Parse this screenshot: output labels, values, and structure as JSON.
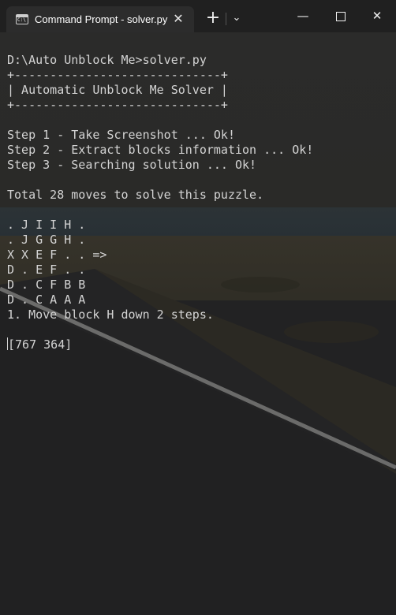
{
  "window": {
    "tab_title": "Command Prompt - solver.py",
    "tab_close_glyph": "✕",
    "new_tab_glyph": "+",
    "dropdown_glyph": "⌄",
    "minimize_glyph": "—",
    "close_glyph": "✕"
  },
  "icons": {
    "tab": "console-icon",
    "tab_close": "close-icon",
    "new_tab": "plus-icon",
    "dropdown": "chevron-down-icon",
    "minimize": "minimize-icon",
    "maximize": "maximize-icon",
    "close": "close-icon"
  },
  "console": {
    "lines": [
      "D:\\Auto Unblock Me>solver.py",
      "+-----------------------------+",
      "| Automatic Unblock Me Solver |",
      "+-----------------------------+",
      "",
      "Step 1 - Take Screenshot ... Ok!",
      "Step 2 - Extract blocks information ... Ok!",
      "Step 3 - Searching solution ... Ok!",
      "",
      "Total 28 moves to solve this puzzle.",
      "",
      ". J I I H .",
      ". J G G H .",
      "X X E F . . =>",
      "D . E F . .",
      "D . C F B B",
      "D . C A A A",
      "1. Move block H down 2 steps.",
      ""
    ],
    "prompt_line": "[767 364]"
  }
}
